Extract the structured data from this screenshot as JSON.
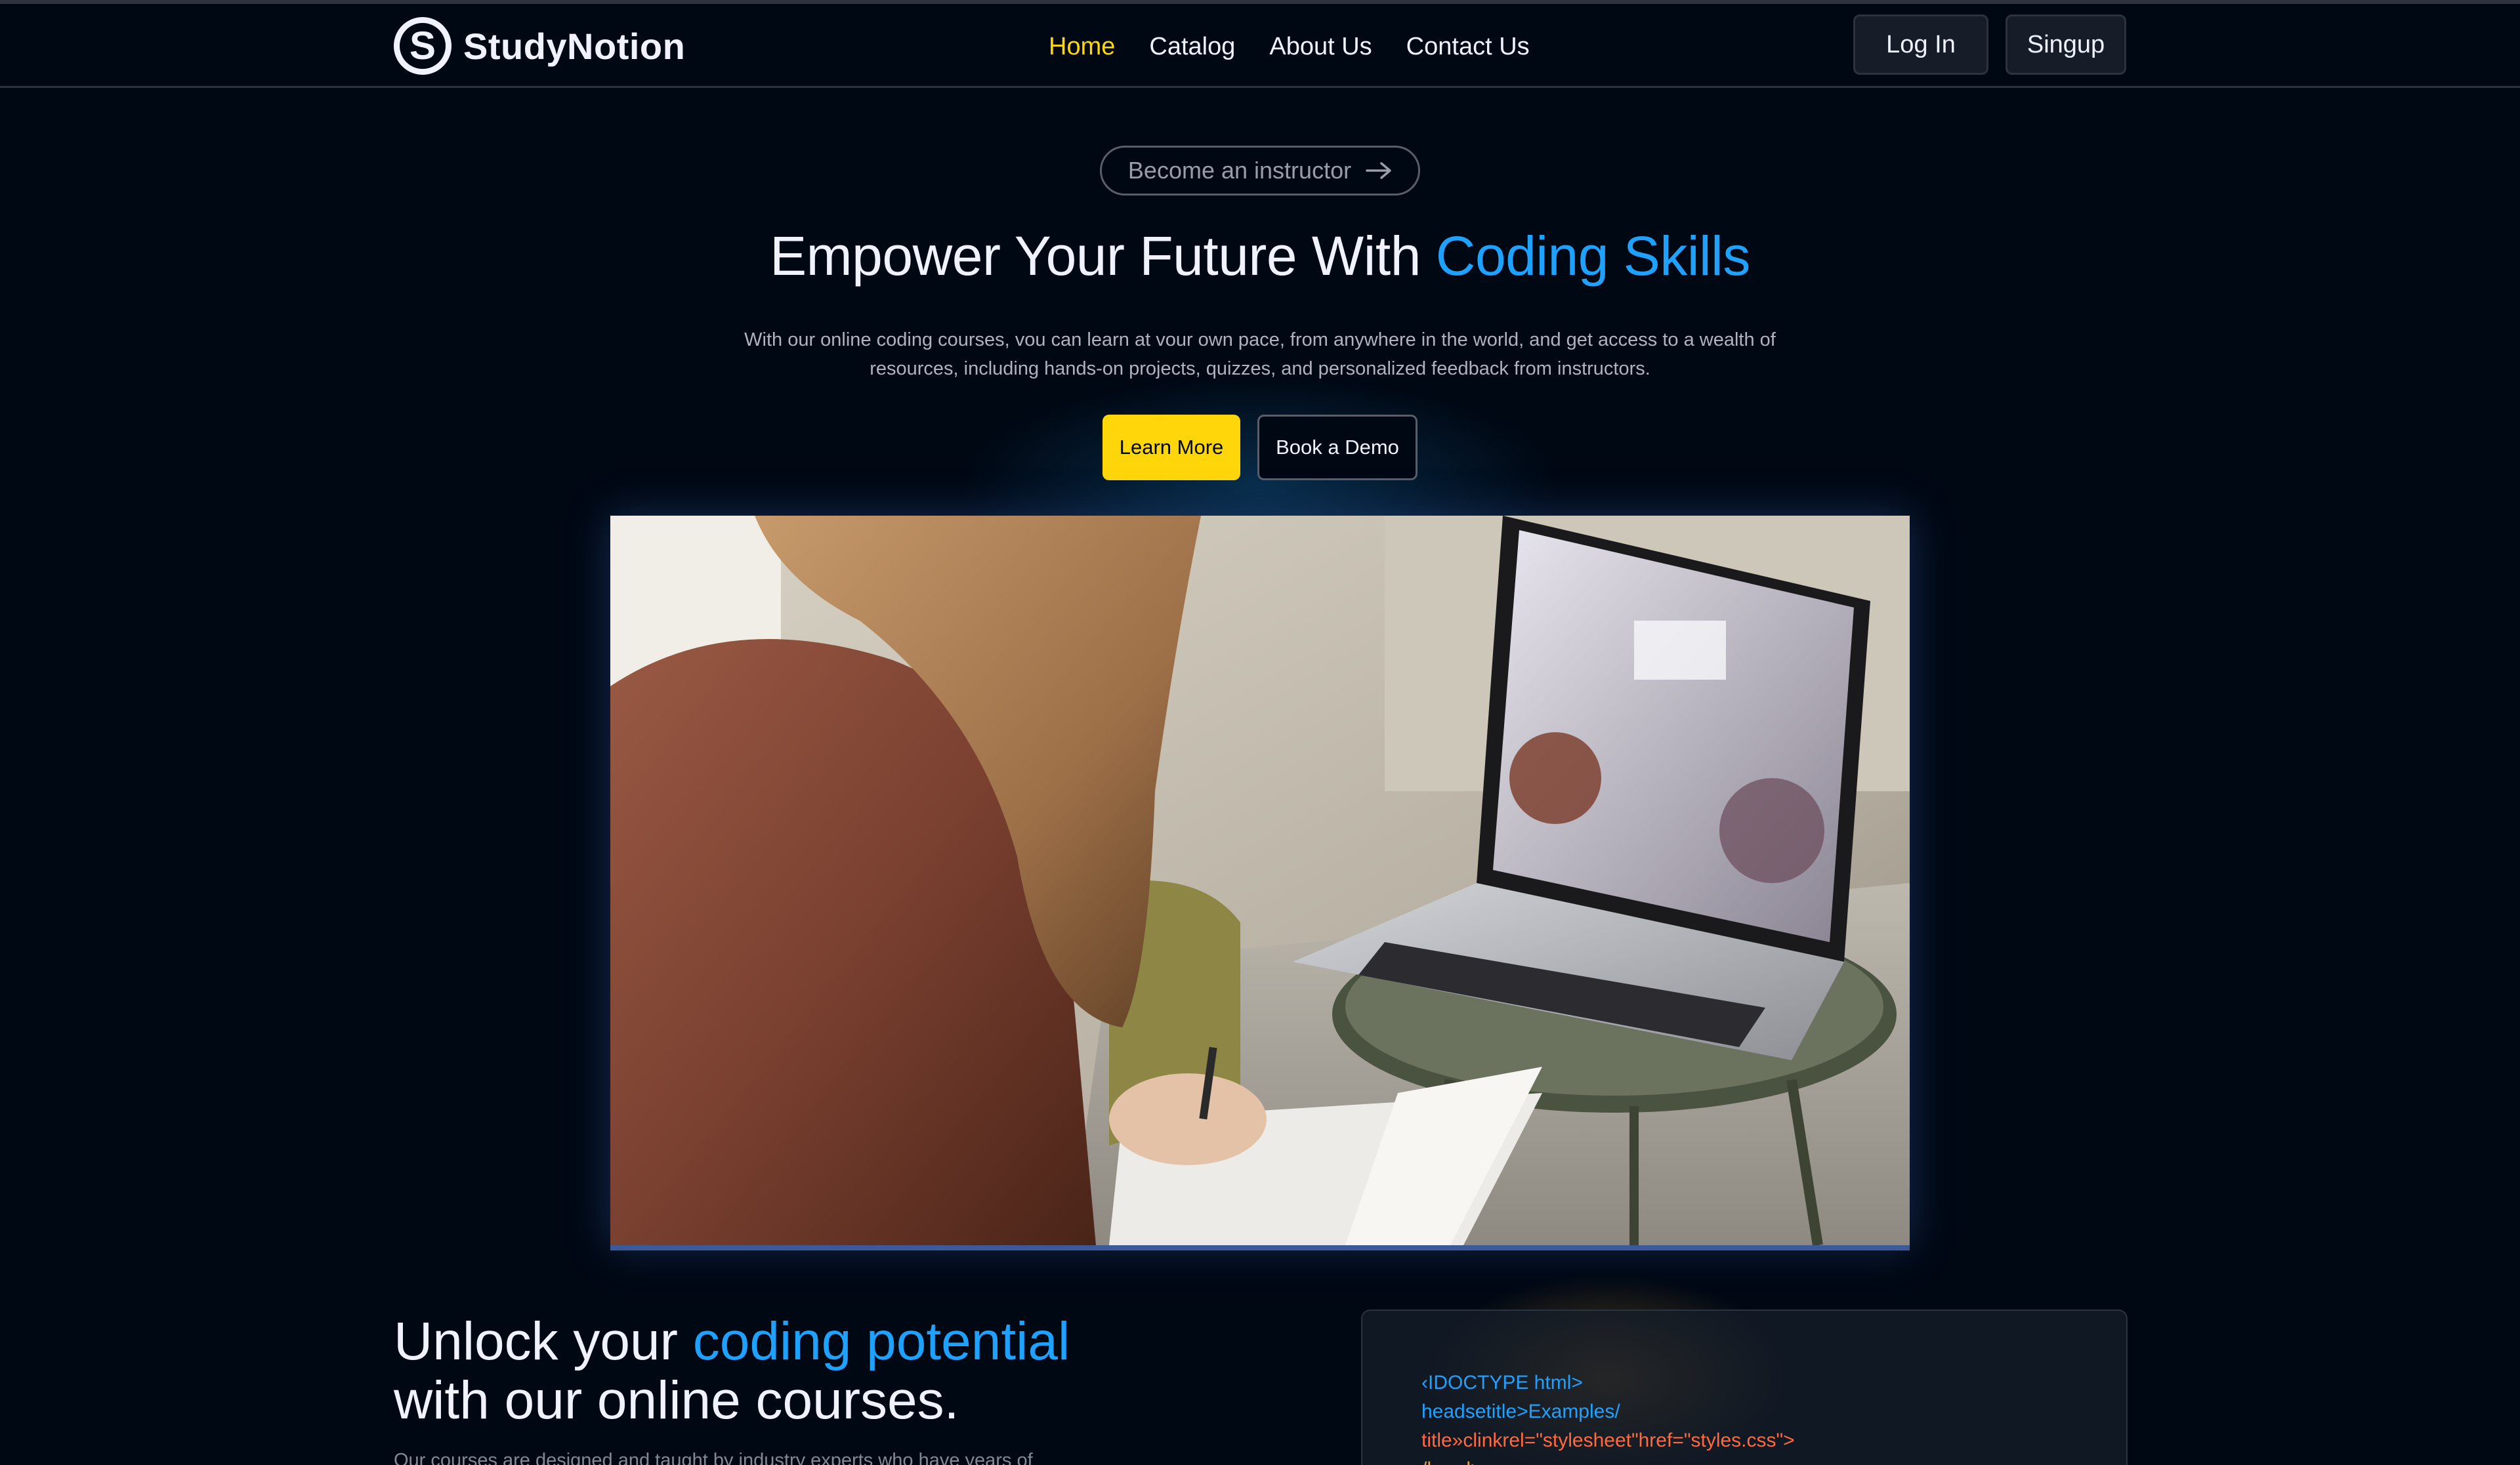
{
  "brand": {
    "logo_letter": "S",
    "name": "StudyNotion"
  },
  "nav": {
    "links": [
      "Home",
      "Catalog",
      "About Us",
      "Contact Us"
    ],
    "active_index": 0
  },
  "auth": {
    "login_label": "Log In",
    "signup_label": "Singup"
  },
  "hero": {
    "pill_label": "Become an instructor",
    "title_plain": "Empower Your Future With ",
    "title_accent": "Coding Skills",
    "subtitle": "With our online coding courses, vou can learn at vour own pace, from anywhere in the world, and get access to a wealth of resources, including hands-on projects, quizzes, and personalized feedback from instructors.",
    "learn_more_label": "Learn More",
    "book_demo_label": "Book a Demo"
  },
  "section2": {
    "heading_plain_1": "Unlock your ",
    "heading_accent": "coding potential",
    "heading_plain_2": "with our online courses.",
    "subtitle": "Our courses are designed and taught by industry experts who have years of",
    "code_lines": [
      "‹IDOCTYPE html>",
      "headsetitle>Examples/",
      "title»clinkrel=\"stylesheet\"href=\"styles.css\">",
      "/head>"
    ]
  },
  "colors": {
    "background": "#000814",
    "accent_yellow": "#FFD60A",
    "accent_blue": "#1FA2FF",
    "text_primary": "#F1F2FF",
    "text_muted": "#AFB2BF",
    "border": "#2C333F"
  }
}
